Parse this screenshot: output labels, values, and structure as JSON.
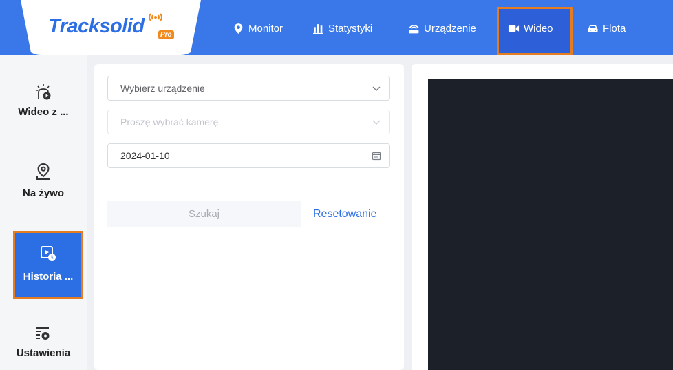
{
  "header": {
    "logo_text": "Tracksolid",
    "logo_badge": "Pro",
    "nav": [
      {
        "label": "Monitor",
        "icon": "location-pin-icon"
      },
      {
        "label": "Statystyki",
        "icon": "bar-chart-icon"
      },
      {
        "label": "Urządzenie",
        "icon": "router-icon"
      },
      {
        "label": "Wideo",
        "icon": "video-camera-icon",
        "active": true
      },
      {
        "label": "Flota",
        "icon": "car-icon"
      }
    ]
  },
  "sidebar": {
    "items": [
      {
        "label": "Wideo z ...",
        "icon": "live-video-icon"
      },
      {
        "label": "Na żywo",
        "icon": "map-pin-icon"
      },
      {
        "label": "Historia ...",
        "icon": "playback-history-icon",
        "active": true
      },
      {
        "label": "Ustawienia",
        "icon": "settings-list-icon"
      }
    ]
  },
  "filters": {
    "device_placeholder": "Wybierz urządzenie",
    "camera_placeholder": "Proszę wybrać kamerę",
    "date_value": "2024-01-10",
    "search_label": "Szukaj",
    "reset_label": "Resetowanie"
  },
  "colors": {
    "accent": "#3a78ea",
    "highlight": "#e47c22",
    "video_bg": "#1b2029"
  }
}
